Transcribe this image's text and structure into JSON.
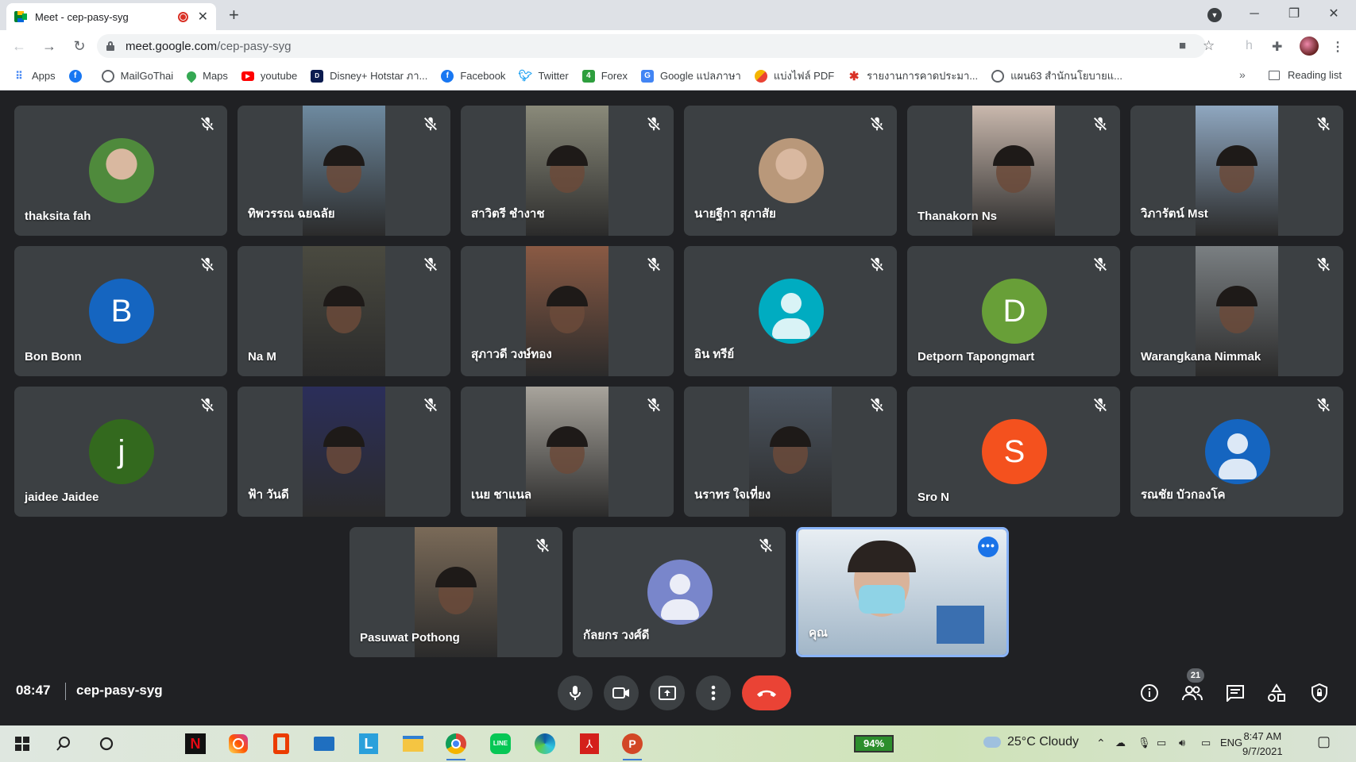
{
  "browser": {
    "tab_title": "Meet - cep-pasy-syg",
    "url_host": "meet.google.com",
    "url_path": "/cep-pasy-syg",
    "bookmarks": [
      {
        "label": "Apps",
        "color": "#4285f4",
        "glyph": "⋮⋮"
      },
      {
        "label": "",
        "color": "#1877f2",
        "glyph": "f"
      },
      {
        "label": "MailGoThai",
        "color": "#5f6368",
        "glyph": "◎"
      },
      {
        "label": "Maps",
        "color": "#34a853",
        "glyph": "●"
      },
      {
        "label": "youtube",
        "color": "#ff0000",
        "glyph": "▶"
      },
      {
        "label": "Disney+ Hotstar ภา...",
        "color": "#0b1b4f",
        "glyph": "D"
      },
      {
        "label": "Facebook",
        "color": "#1877f2",
        "glyph": "f"
      },
      {
        "label": "Twitter",
        "color": "#1da1f2",
        "glyph": "t"
      },
      {
        "label": "Forex",
        "color": "#2e9e3e",
        "glyph": "4"
      },
      {
        "label": "Google แปลภาษา",
        "color": "#4285f4",
        "glyph": "G"
      },
      {
        "label": "แบ่งไฟล์ PDF",
        "color": "#f4b400",
        "glyph": "●"
      },
      {
        "label": "รายงานการคาดประมา...",
        "color": "#d93025",
        "glyph": "✱"
      },
      {
        "label": "แผน63 สำนักนโยบายแ...",
        "color": "#5f6368",
        "glyph": "◎"
      }
    ],
    "reading_list": "Reading list"
  },
  "tiles": [
    {
      "name": "thaksita fah",
      "kind": "avatar",
      "color": "#4f8a3c"
    },
    {
      "name": "ทิพวรรณ ฉยฉลัย",
      "kind": "video",
      "color": "#6e8aa0"
    },
    {
      "name": "สาวิตรี ชำงาช",
      "kind": "video",
      "color": "#8a8a7a"
    },
    {
      "name": "นายฐีกา สุภาสัย",
      "kind": "avatar",
      "color": "#b9987a"
    },
    {
      "name": "Thanakorn Ns",
      "kind": "video",
      "color": "#c9b8ad"
    },
    {
      "name": "วิภารัตน์ Mst",
      "kind": "video",
      "color": "#8fa7c0"
    },
    {
      "name": "Bon Bonn",
      "kind": "letter",
      "letter": "B",
      "color": "#1565c0"
    },
    {
      "name": "Na M",
      "kind": "video",
      "color": "#4a4a40"
    },
    {
      "name": "สุภาวดี วงษ์ทอง",
      "kind": "video",
      "color": "#8a5a44"
    },
    {
      "name": "อิน ทรีย์",
      "kind": "person",
      "color": "#00acc1"
    },
    {
      "name": "Detporn Tapongmart",
      "kind": "letter",
      "letter": "D",
      "color": "#689f38"
    },
    {
      "name": "Warangkana Nimmak",
      "kind": "video",
      "color": "#7a7f82"
    },
    {
      "name": "jaidee Jaidee",
      "kind": "letter",
      "letter": "j",
      "color": "#33691e"
    },
    {
      "name": "ฟ้า วันดี",
      "kind": "video",
      "color": "#2b2e5a"
    },
    {
      "name": "เนย ชาแนล",
      "kind": "video",
      "color": "#a8a49c"
    },
    {
      "name": "นราทร ใจเที่ยง",
      "kind": "video",
      "color": "#4c5560"
    },
    {
      "name": "Sro N",
      "kind": "letter",
      "letter": "S",
      "color": "#f4511e"
    },
    {
      "name": "รณชัย บัวกองโค",
      "kind": "person",
      "color": "#1565c0"
    },
    {
      "name": "Pasuwat Pothong",
      "kind": "video",
      "color": "#7a6a58"
    },
    {
      "name": "กัลยกร วงศ์ดี",
      "kind": "person",
      "color": "#7986cb"
    },
    {
      "name": "คุณ",
      "kind": "self",
      "color": "#9fb4c6"
    }
  ],
  "meeting": {
    "time": "08:47",
    "code": "cep-pasy-syg",
    "participants_count": "21"
  },
  "taskbar": {
    "battery": "94%",
    "weather": "25°C  Cloudy",
    "lang": "ENG",
    "time": "8:47 AM",
    "date": "9/7/2021"
  }
}
